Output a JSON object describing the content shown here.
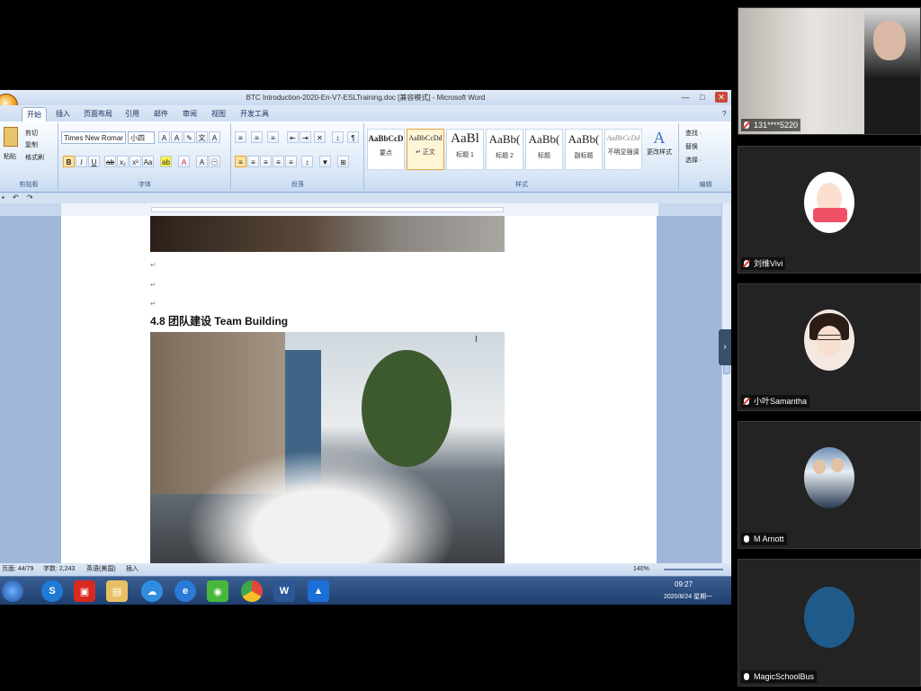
{
  "window": {
    "title": "BTC Introduction-2020-En-V7-ESLTraining.doc [兼容模式] - Microsoft Word",
    "min": "—",
    "max": "□",
    "close": "✕"
  },
  "tabs": [
    "开始",
    "插入",
    "页面布局",
    "引用",
    "邮件",
    "审阅",
    "视图",
    "开发工具"
  ],
  "ribbon": {
    "clipboard": {
      "paste": "粘贴",
      "cut": "剪切",
      "copy": "复制",
      "format_painter": "格式刷",
      "label": "剪贴板"
    },
    "font": {
      "name": "Times New Romar",
      "size": "小四",
      "label": "字体"
    },
    "paragraph": {
      "label": "段落"
    },
    "styles": {
      "label": "样式",
      "items": [
        {
          "sample": "AaBbCcD",
          "name": "要点"
        },
        {
          "sample": "AaBbCcDd",
          "name": "↵ 正文"
        },
        {
          "sample": "AaBl",
          "name": "标题 1"
        },
        {
          "sample": "AaBb(",
          "name": "标题 2"
        },
        {
          "sample": "AaBb(",
          "name": "标题"
        },
        {
          "sample": "AaBb(",
          "name": "副标题"
        },
        {
          "sample": "AaBbCcDd",
          "name": "不明显强调"
        }
      ],
      "change_styles": "更改样式"
    },
    "editing": {
      "find": "查找 ·",
      "replace": "替换",
      "select": "选择 ·",
      "label": "编辑"
    }
  },
  "document": {
    "heading": "4.8 团队建设 Team Building",
    "para_mark": "↵"
  },
  "status": {
    "page": "页面: 44/79",
    "words": "字数: 2,243",
    "language": "英语(美国)",
    "insert": "插入",
    "zoom": "140%"
  },
  "taskbar": {
    "time": "09:27",
    "date": "2020/8/24 星期一",
    "icons": [
      "start-orb",
      "sogou-icon",
      "app-red-icon",
      "explorer-folder-icon",
      "cloud-icon",
      "ie-icon",
      "wechat-icon",
      "chrome-icon",
      "word-icon",
      "mountain-app-icon"
    ]
  },
  "participants": [
    {
      "name": "131****5220",
      "muted": true
    },
    {
      "name": "刘维Vivi",
      "muted": true
    },
    {
      "name": "小叶Samantha",
      "muted": true
    },
    {
      "name": "M Arnott",
      "muted": false
    },
    {
      "name": "MagicSchoolBus",
      "muted": false
    }
  ],
  "colors": {
    "ribbon_bg": "#dce8f7",
    "taskbar": "#1f3f6e",
    "video_tile": "#232323",
    "muted_red": "#e53935"
  }
}
